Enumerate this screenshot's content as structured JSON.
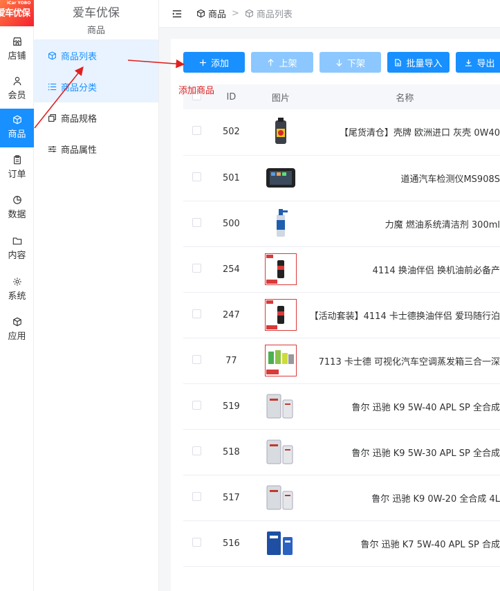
{
  "logo": {
    "en": "iCar YOBO",
    "cn": "爱车优保"
  },
  "rail": [
    {
      "name": "rail-store",
      "icon": "store-icon",
      "label": "店铺"
    },
    {
      "name": "rail-member",
      "icon": "user-icon",
      "label": "会员"
    },
    {
      "name": "rail-goods",
      "icon": "box-icon",
      "label": "商品",
      "active": true
    },
    {
      "name": "rail-order",
      "icon": "clipboard-icon",
      "label": "订单"
    },
    {
      "name": "rail-data",
      "icon": "pie-chart-icon",
      "label": "数据"
    },
    {
      "name": "rail-content",
      "icon": "folder-icon",
      "label": "内容"
    },
    {
      "name": "rail-system",
      "icon": "gear-icon",
      "label": "系统"
    },
    {
      "name": "rail-app",
      "icon": "cube-icon",
      "label": "应用"
    }
  ],
  "subnav": {
    "title": "爱车优保",
    "subtitle": "商品",
    "items": [
      {
        "label": "商品列表",
        "icon": "box-icon"
      },
      {
        "label": "商品分类",
        "icon": "list-icon"
      },
      {
        "label": "商品规格",
        "icon": "copy-icon"
      },
      {
        "label": "商品属性",
        "icon": "sliders-icon"
      }
    ]
  },
  "breadcrumb": {
    "root": "商品",
    "sep": ">",
    "current": "商品列表"
  },
  "toolbar": {
    "add": "添加",
    "on_shelf": "上架",
    "off_shelf": "下架",
    "batch_import": "批量导入",
    "export": "导出"
  },
  "annotation": {
    "label": "添加商品",
    "color": "#e02020"
  },
  "table": {
    "headers": {
      "id": "ID",
      "image": "图片",
      "name": "名称"
    },
    "rows": [
      {
        "id": "502",
        "name": "【尾货清仓】壳牌 欧洲进口 灰壳 0W40",
        "img": "oil-bottle"
      },
      {
        "id": "501",
        "name": "道通汽车检测仪MS908S",
        "img": "tablet"
      },
      {
        "id": "500",
        "name": "力魔 燃油系统清洁剂 300ml",
        "img": "cleaner"
      },
      {
        "id": "254",
        "name": "4114 换油伴侣 换机油前必备产",
        "img": "promo"
      },
      {
        "id": "247",
        "name": "【活动套装】4114 卡士德换油伴侣 爱玛随行泊",
        "img": "promo"
      },
      {
        "id": "77",
        "name": "7113 卡士德 可视化汽车空调蒸发箱三合一深",
        "img": "promo-multi"
      },
      {
        "id": "519",
        "name": "鲁尔 迅驰 K9 5W-40 APL SP 全合成",
        "img": "silver-cans"
      },
      {
        "id": "518",
        "name": "鲁尔 迅驰 K9 5W-30 APL SP 全合成",
        "img": "silver-cans"
      },
      {
        "id": "517",
        "name": "鲁尔 迅驰 K9 0W-20 全合成 4L",
        "img": "silver-cans"
      },
      {
        "id": "516",
        "name": "鲁尔 迅驰 K7 5W-40 APL SP 合成",
        "img": "blue-cans"
      }
    ]
  },
  "colors": {
    "primary": "#1890ff",
    "primary_light": "#8cc8ff",
    "annotation": "#e02020"
  }
}
